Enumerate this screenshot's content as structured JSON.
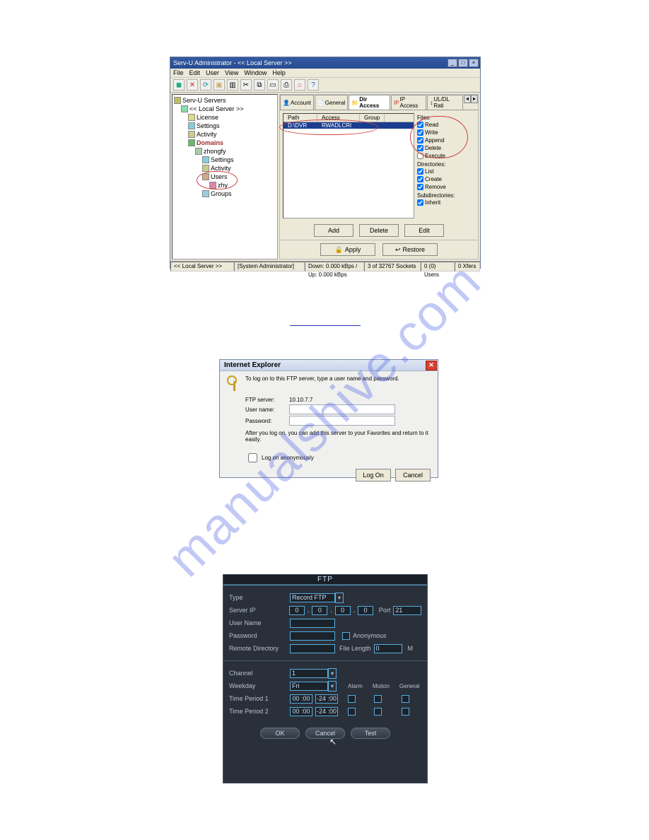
{
  "watermark": "manualshive.com",
  "fig1": {
    "title": "Serv-U Administrator - << Local Server >>",
    "menu": [
      "File",
      "Edit",
      "User",
      "View",
      "Window",
      "Help"
    ],
    "tree": {
      "root": "Serv-U Servers",
      "localserver": "<< Local Server >>",
      "license": "License",
      "settings": "Settings",
      "activity": "Activity",
      "domains": "Domains",
      "domain": "zhongfy",
      "d_settings": "Settings",
      "d_activity": "Activity",
      "d_users": "Users",
      "d_user": "zhy",
      "d_groups": "Groups"
    },
    "tabs": {
      "account": "Account",
      "general": "General",
      "diraccess": "Dir Access",
      "ipaccess": "IP Access",
      "uldl": "UL/DL Rati"
    },
    "list": {
      "hdr_path": "Path",
      "hdr_access": "Access",
      "hdr_group": "Group",
      "row_path": "D:\\DVR",
      "row_access": "RWADLCRI"
    },
    "perms": {
      "files_label": "Files:",
      "read": "Read",
      "write": "Write",
      "append": "Append",
      "delete": "Delete",
      "execute": "Execute",
      "dirs_label": "Directories:",
      "list": "List",
      "create": "Create",
      "remove": "Remove",
      "sub_label": "Subdirectories:",
      "inherit": "Inherit"
    },
    "buttons": {
      "add": "Add",
      "delete": "Delete",
      "edit": "Edit",
      "apply": "Apply",
      "restore": "Restore"
    },
    "status": {
      "s1": "<< Local Server >>",
      "s2": "[System Administrator]",
      "s3": "Down: 0.000 kBps / Up: 0.000 kBps",
      "s4": "3 of 32767 Sockets",
      "s5": "0 (0) Users",
      "s6": "0 Xfers"
    }
  },
  "fig2": {
    "title": "Internet Explorer",
    "instruction": "To log on to this FTP server, type a user name and password.",
    "ftp_label": "FTP server:",
    "ftp_value": "10.10.7.7",
    "user_label": "User name:",
    "pass_label": "Password:",
    "hint": "After you log on, you can add this server to your Favorites and return to it easily.",
    "anon": "Log on anonymously",
    "logon": "Log On",
    "cancel": "Cancel"
  },
  "fig3": {
    "title": "FTP",
    "type_label": "Type",
    "type_value": "Record FTP",
    "serverip_label": "Server IP",
    "ip": [
      "0",
      "0",
      "0",
      "0"
    ],
    "port_label": "Port",
    "port_value": "21",
    "user_label": "User Name",
    "pass_label": "Password",
    "anon_label": "Anonymous",
    "remote_label": "Remote Directory",
    "filelen_label": "File Length",
    "filelen_value": "0",
    "filelen_unit": "M",
    "channel_label": "Channel",
    "channel_value": "1",
    "weekday_label": "Weekday",
    "weekday_value": "Fri",
    "col_alarm": "Alarm",
    "col_motion": "Motion",
    "col_general": "General",
    "tp1_label": "Time Period 1",
    "tp2_label": "Time Period 2",
    "tp_start": "00 :00",
    "tp_end": "-24 :00",
    "ok": "OK",
    "cancel": "Cancel",
    "test": "Test"
  }
}
